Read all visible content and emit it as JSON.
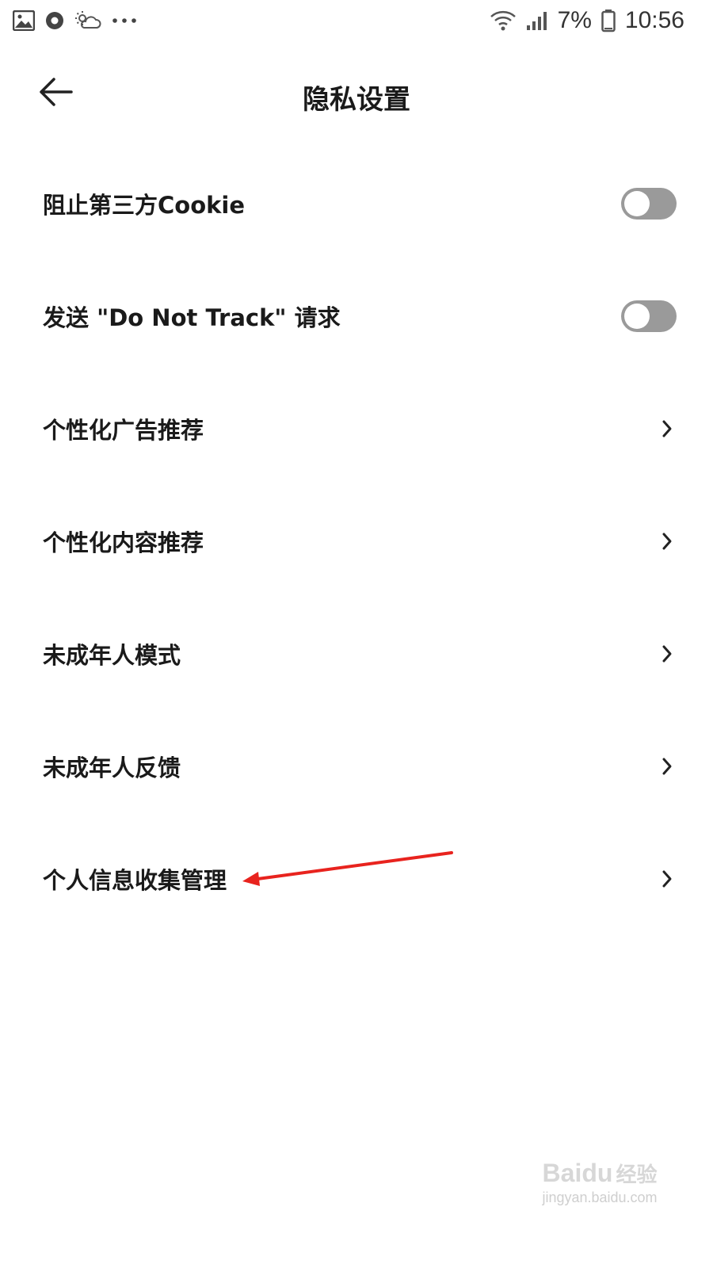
{
  "status_bar": {
    "battery_percent": "7%",
    "time": "10:56",
    "icons": [
      "gallery-icon",
      "record-icon",
      "weather-icon",
      "more-dots-icon",
      "wifi-icon",
      "signal-icon",
      "battery-icon"
    ]
  },
  "header": {
    "title": "隐私设置",
    "back_icon": "arrow-left-icon"
  },
  "settings": [
    {
      "label": "阻止第三方Cookie",
      "control": "toggle",
      "enabled": false
    },
    {
      "label": "发送 \"Do Not Track\" 请求",
      "control": "toggle",
      "enabled": false
    },
    {
      "label": "个性化广告推荐",
      "control": "chevron"
    },
    {
      "label": "个性化内容推荐",
      "control": "chevron"
    },
    {
      "label": "未成年人模式",
      "control": "chevron"
    },
    {
      "label": "未成年人反馈",
      "control": "chevron"
    },
    {
      "label": "个人信息收集管理",
      "control": "chevron"
    }
  ],
  "colors": {
    "toggle_off": "#9a9a9a",
    "annotation_arrow": "#e8231e",
    "text": "#1a1a1a"
  },
  "watermark": {
    "brand": "Baidu",
    "sub": "经验",
    "url": "jingyan.baidu.com"
  }
}
